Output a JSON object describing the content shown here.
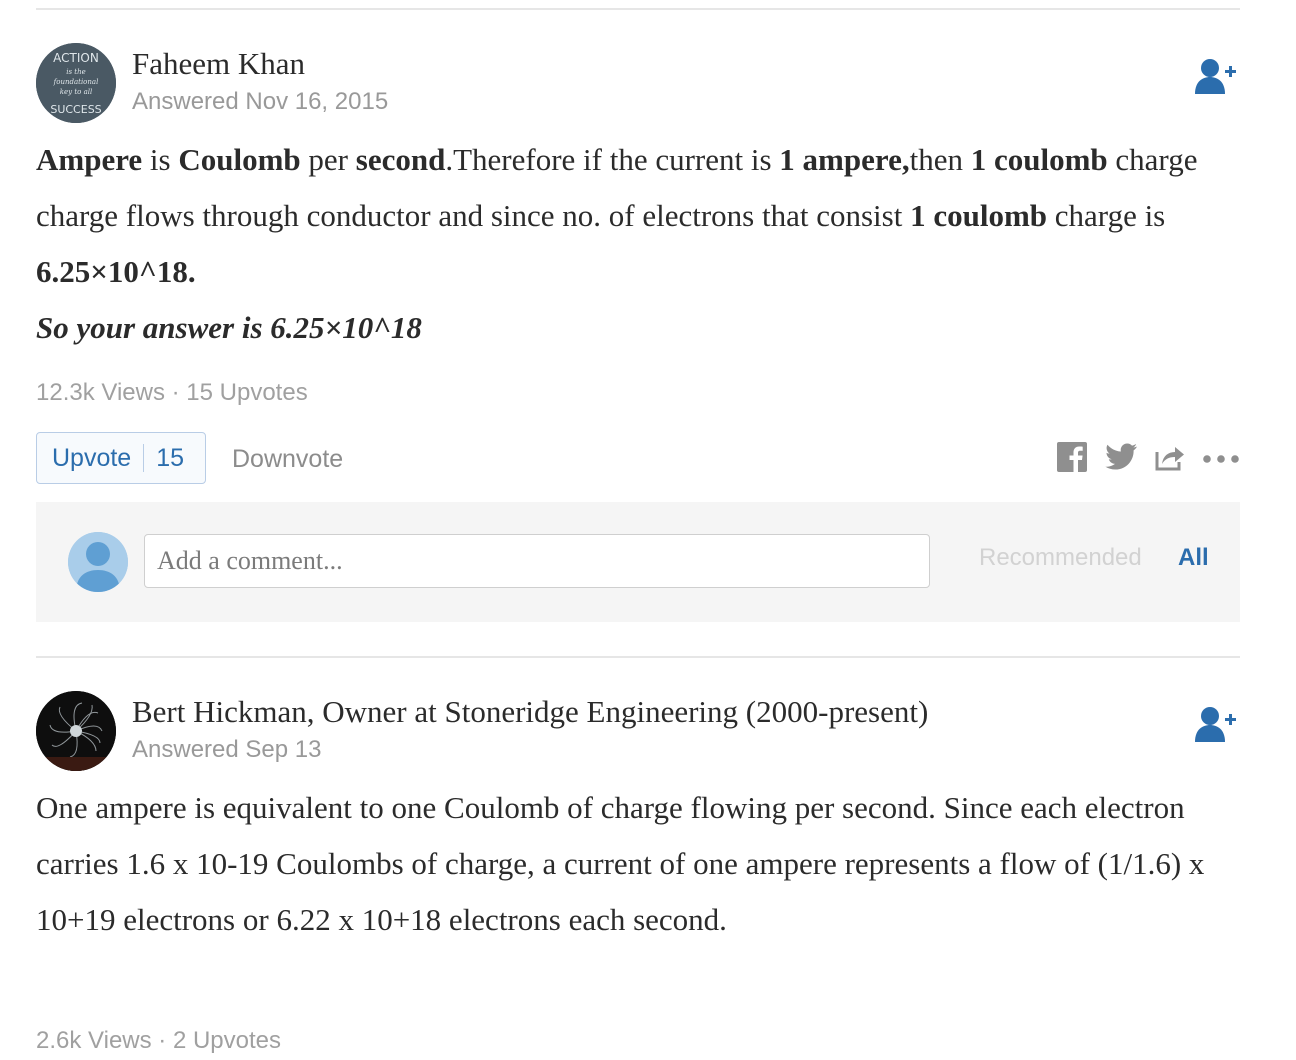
{
  "answers": [
    {
      "author": "Faheem Khan",
      "answered": "Answered Nov 16, 2015",
      "avatar_text": [
        "ACTION",
        "is the",
        "foundational",
        "key to all",
        "SUCCESS"
      ],
      "body_paragraphs": [
        [
          {
            "text": "Ampere",
            "bold": true
          },
          {
            "text": " is ",
            "bold": false
          },
          {
            "text": "Coulomb",
            "bold": true
          },
          {
            "text": " per ",
            "bold": false
          },
          {
            "text": "second",
            "bold": true
          },
          {
            "text": ".Therefore if the current is ",
            "bold": false
          },
          {
            "text": "1 ampere,",
            "bold": true
          },
          {
            "text": "then ",
            "bold": false
          },
          {
            "text": "1 coulomb",
            "bold": true
          },
          {
            "text": " charge charge flows through conductor and since no. of electrons that consist ",
            "bold": false
          },
          {
            "text": "1 coulomb",
            "bold": true
          },
          {
            "text": " charge is ",
            "bold": false
          },
          {
            "text": "6.25×10^18.",
            "bold": true
          }
        ],
        [
          {
            "text": "So your answer is 6.25×10^18",
            "bold": true,
            "italic": true
          }
        ]
      ],
      "stats": "12.3k Views · 15 Upvotes",
      "upvote_label": "Upvote",
      "upvote_count": "15",
      "downvote_label": "Downvote"
    },
    {
      "author": "Bert Hickman, Owner at Stoneridge Engineering (2000-present)",
      "answered": "Answered Sep 13",
      "body_paragraphs": [
        [
          {
            "text": "One ampere is equivalent to one Coulomb of charge flowing per second. Since each electron carries 1.6 x 10-19 Coulombs of charge, a current of one ampere represents a flow of (1/1.6) x 10+19 electrons or 6.22 x 10+18 electrons each second.",
            "bold": false
          }
        ]
      ],
      "stats": "2.6k Views · 2 Upvotes"
    }
  ],
  "comment": {
    "placeholder": "Add a comment...",
    "recommended_label": "Recommended",
    "all_label": "All"
  },
  "icons": {
    "follow": "add-user-icon",
    "facebook": "facebook-icon",
    "twitter": "twitter-icon",
    "share": "share-icon",
    "more": "more-icon"
  },
  "colors": {
    "accent": "#2b6dad",
    "muted_text": "#999999",
    "comment_bg": "#f5f5f5",
    "avatar_blue": "#a9cdea"
  }
}
